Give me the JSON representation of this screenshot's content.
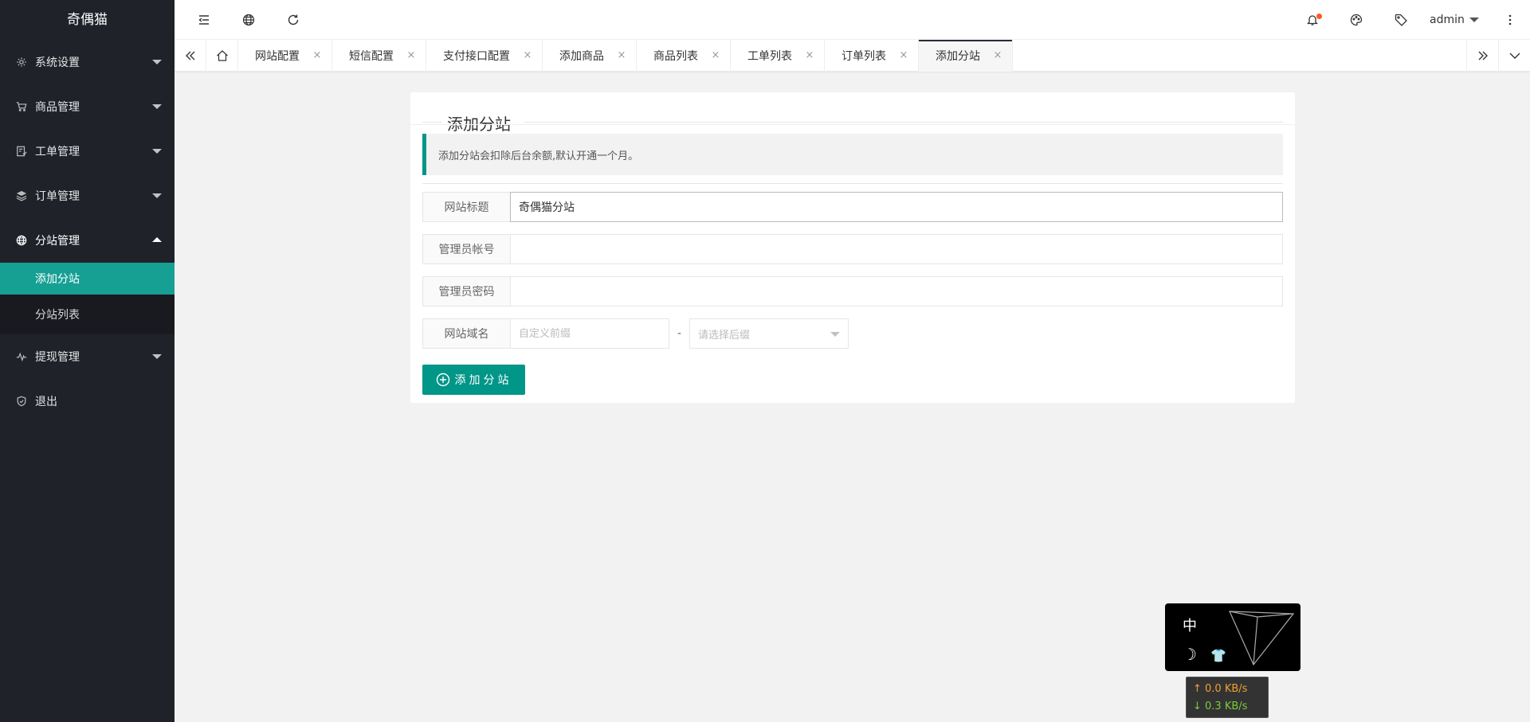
{
  "app": {
    "title": "奇偶猫"
  },
  "sidebar": {
    "items": [
      {
        "label": "系统设置",
        "icon": "gear-icon"
      },
      {
        "label": "商品管理",
        "icon": "cart-icon"
      },
      {
        "label": "工单管理",
        "icon": "ticket-icon"
      },
      {
        "label": "订单管理",
        "icon": "layers-icon"
      },
      {
        "label": "分站管理",
        "icon": "globe-icon",
        "open": true
      },
      {
        "label": "提现管理",
        "icon": "pulse-icon"
      },
      {
        "label": "退出",
        "icon": "shield-icon"
      }
    ],
    "submenu": [
      {
        "label": "添加分站",
        "active": true
      },
      {
        "label": "分站列表"
      }
    ]
  },
  "header": {
    "user": "admin",
    "colors": {
      "notify_dot": "#ff5722"
    }
  },
  "tabs": [
    {
      "label": "网站配置"
    },
    {
      "label": "短信配置"
    },
    {
      "label": "支付接口配置"
    },
    {
      "label": "添加商品"
    },
    {
      "label": "商品列表"
    },
    {
      "label": "工单列表"
    },
    {
      "label": "订单列表"
    },
    {
      "label": "添加分站",
      "active": true
    }
  ],
  "tab_close_glyph": "×",
  "card": {
    "legend": "添加分站",
    "notice": "添加分站会扣除后台余额,默认开通一个月。",
    "fields": {
      "site_title_label": "网站标题",
      "site_title_value": "奇偶猫分站",
      "admin_account_label": "管理员帐号",
      "admin_account_value": "",
      "admin_password_label": "管理员密码",
      "admin_password_value": "",
      "domain_label": "网站域名",
      "domain_prefix_placeholder": "自定义前缀",
      "domain_dash": "-",
      "domain_suffix_placeholder": "请选择后缀"
    },
    "submit_label": "添加分站"
  },
  "widget": {
    "lang_label": "中",
    "moon_glyph": "☽",
    "shirt_glyph": "👕"
  },
  "netspeed": {
    "up": "↑ 0.0 KB/s",
    "down": "↓ 0.3 KB/s"
  },
  "colors": {
    "accent": "#009688",
    "sidebar_bg": "#20222a",
    "sidebar_active": "#16a094"
  }
}
